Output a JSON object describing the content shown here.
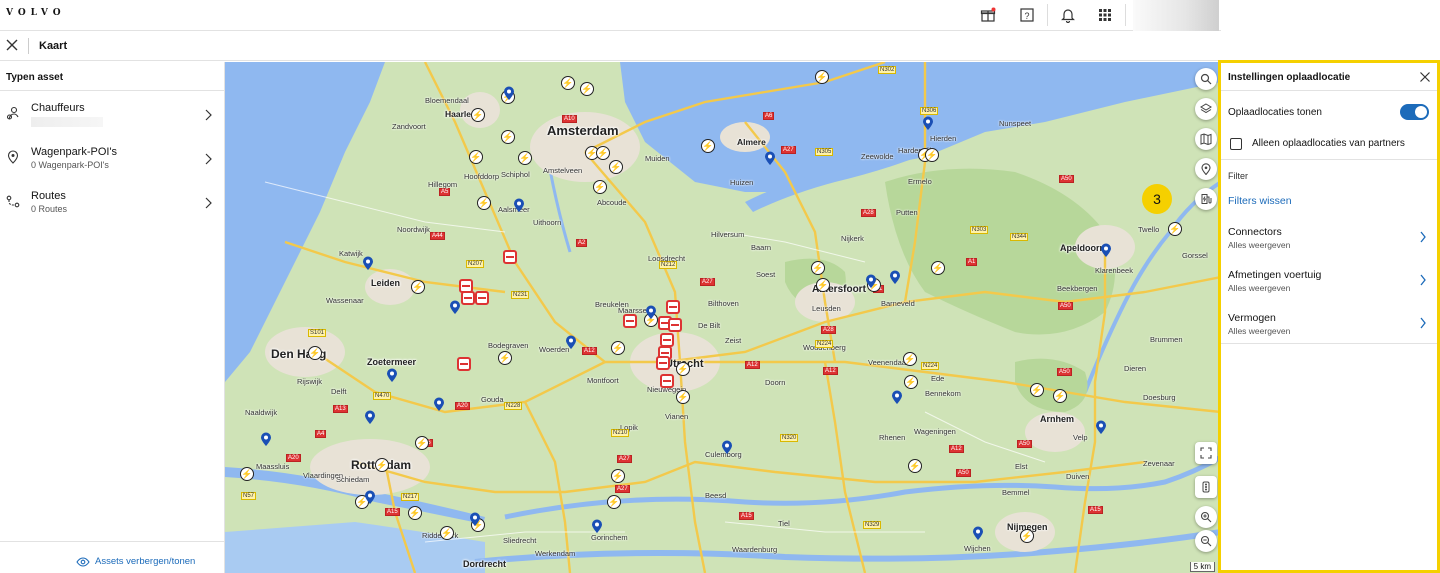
{
  "header": {
    "logo": "VOLVO",
    "icons": [
      "gift-icon",
      "help-icon",
      "bell-icon",
      "apps-grid-icon"
    ]
  },
  "subbar": {
    "title": "Kaart"
  },
  "left_panel": {
    "heading": "Typen asset",
    "assets": [
      {
        "label": "Chauffeurs",
        "sub": "",
        "icon": "driver-icon"
      },
      {
        "label": "Wagenpark-POI's",
        "sub": "0 Wagenpark-POI's",
        "icon": "location-pin-icon"
      },
      {
        "label": "Routes",
        "sub": "0 Routes",
        "icon": "route-icon"
      }
    ],
    "footer_link": "Assets verbergen/tonen"
  },
  "map": {
    "cities": [
      "Amsterdam",
      "Den Haag",
      "Rotterdam",
      "Utrecht",
      "Amersfoort",
      "Apeldoorn",
      "Arnhem",
      "Nijmegen",
      "Leiden",
      "Zoetermeer",
      "Dordrecht",
      "Haarlem",
      "Almere"
    ],
    "towns": [
      "Bloemendaal",
      "Zandvoort",
      "Hillegom",
      "Katwijk",
      "Wassenaar",
      "Noordwijk",
      "Schiphol",
      "Amstelveen",
      "Hoofddorp",
      "Aalsmeer",
      "Uithoorn",
      "Abcoude",
      "Muiden",
      "Huizen",
      "Hilversum",
      "Loosdrecht",
      "Breukelen",
      "Maarssen",
      "Woerden",
      "Gouda",
      "Bodegraven",
      "Montfoort",
      "Nieuwegein",
      "Vianen",
      "Zeist",
      "De Bilt",
      "Bilthoven",
      "Soest",
      "Baarn",
      "Nijkerk",
      "Putten",
      "Ermelo",
      "Harderwijk",
      "Hierden",
      "Nunspeet",
      "Zeewolde",
      "Barneveld",
      "Leusden",
      "Woudenberg",
      "Veenendaal",
      "Ede",
      "Wageningen",
      "Rhenen",
      "Culemborg",
      "Beesd",
      "Gorinchem",
      "Sliedrecht",
      "Ridderkerk",
      "Maassluis",
      "Vlaardingen",
      "Schiedam",
      "Delft",
      "Rijswijk",
      "Naaldwijk",
      "Gorssel",
      "Twello",
      "Klarenbeek",
      "Beekbergen",
      "Brummen",
      "Velp",
      "Duiven",
      "Zevenaar",
      "Doesburg",
      "Dieren",
      "Bemmel",
      "Wijchen",
      "Elst",
      "Bennekom",
      "Doorn",
      "Lopik",
      "Werkendam",
      "Waardenburg",
      "Tiel"
    ],
    "scale": "5 km",
    "controls": [
      "search-icon",
      "layers-icon",
      "map-book-icon",
      "poi-pin-icon",
      "charging-station-icon",
      "fullscreen-icon",
      "traffic-icon",
      "zoom-in-icon",
      "zoom-out-icon"
    ]
  },
  "badge": "3",
  "settings_panel": {
    "title": "Instellingen oplaadlocatie",
    "show_toggle_label": "Oplaadlocaties tonen",
    "show_toggle_on": true,
    "partners_label": "Alleen oplaadlocaties van partners",
    "partners_checked": false,
    "filter_caption": "Filter",
    "clear_filters": "Filters wissen",
    "filters": [
      {
        "title": "Connectors",
        "value": "Alles weergeven"
      },
      {
        "title": "Afmetingen voertuig",
        "value": "Alles weergeven"
      },
      {
        "title": "Vermogen",
        "value": "Alles weergeven"
      }
    ],
    "accent": "#1c6bba",
    "highlight": "#f5d000"
  }
}
